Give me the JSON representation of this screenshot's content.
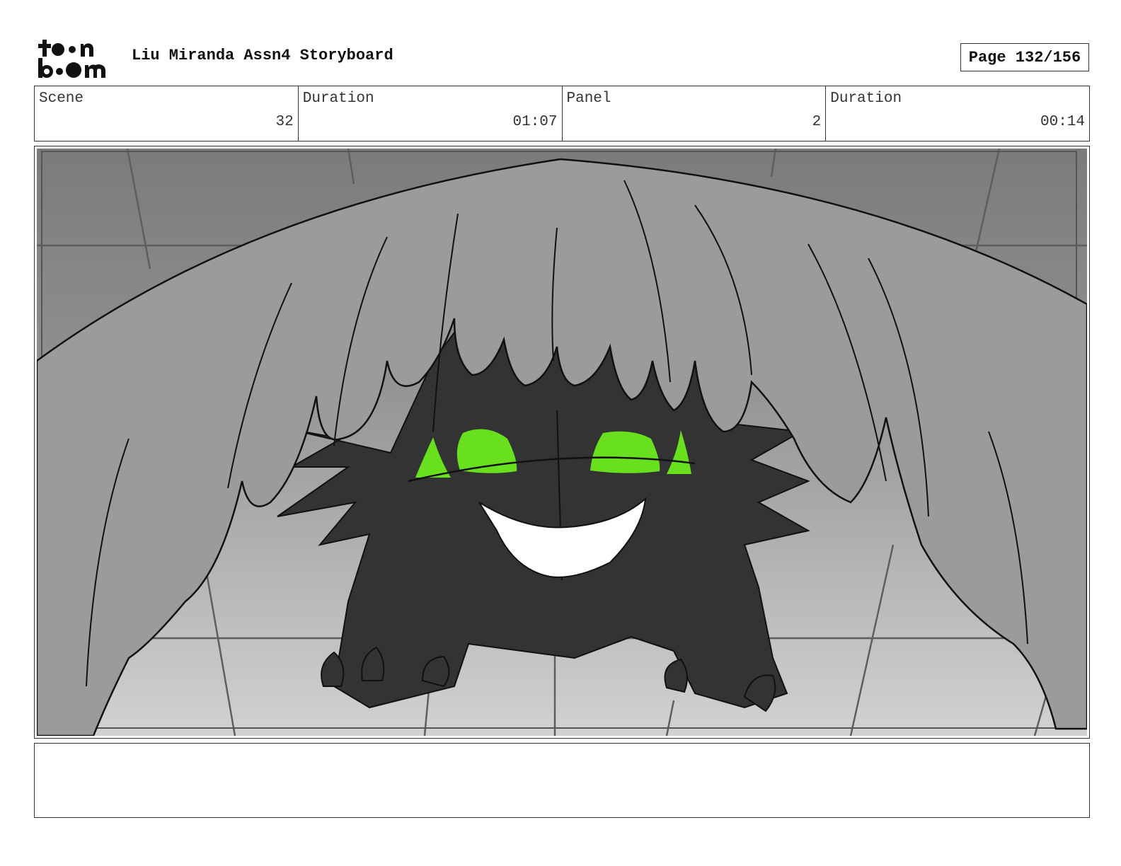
{
  "header": {
    "logo_text": "toon boom",
    "title": "Liu Miranda Assn4 Storyboard",
    "page_label": "Page 132/156"
  },
  "info": {
    "scene_label": "Scene",
    "scene_value": "32",
    "scene_duration_label": "Duration",
    "scene_duration_value": "01:07",
    "panel_label": "Panel",
    "panel_value": "2",
    "panel_duration_label": "Duration",
    "panel_duration_value": "00:14"
  },
  "panel": {
    "illustration": "dark-furry-creature-under-grey-wings",
    "colors": {
      "background_light": "#cfcfcf",
      "background_dark": "#7a7a7a",
      "wing": "#9a9a9a",
      "wing_shadow": "#767676",
      "creature": "#333333",
      "eyes": "#68e01e",
      "teeth": "#ffffff",
      "ink": "#111111"
    }
  },
  "caption": {
    "text": ""
  }
}
